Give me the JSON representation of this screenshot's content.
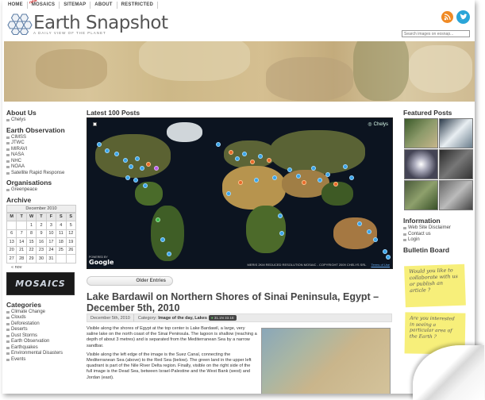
{
  "nav": [
    "HOME",
    "MOSAICS",
    "SITEMAP",
    "ABOUT",
    "RESTRICTED"
  ],
  "nav_new": "new",
  "site": {
    "title": "Earth Snapshot",
    "tagline": "A DAILY VIEW OF THE PLANET"
  },
  "search": {
    "placeholder": "Search images on eosnap..."
  },
  "left": {
    "about_title": "About Us",
    "about_items": [
      "Chelys"
    ],
    "eo_title": "Earth Observation",
    "eo_items": [
      "CIMSS",
      "JTWC",
      "MIRAVI",
      "NASA",
      "NHC",
      "NOAA",
      "Satellite Rapid Response"
    ],
    "org_title": "Organisations",
    "org_items": [
      "Greenpeace"
    ],
    "archive_title": "Archive",
    "calendar": {
      "month": "December 2010",
      "days": [
        "M",
        "T",
        "W",
        "T",
        "F",
        "S",
        "S"
      ],
      "weeks": [
        [
          "",
          "",
          "1",
          "2",
          "3",
          "4",
          "5"
        ],
        [
          "6",
          "7",
          "8",
          "9",
          "10",
          "11",
          "12"
        ],
        [
          "13",
          "14",
          "15",
          "16",
          "17",
          "18",
          "19"
        ],
        [
          "20",
          "21",
          "22",
          "23",
          "24",
          "25",
          "26"
        ],
        [
          "27",
          "28",
          "29",
          "30",
          "31",
          "",
          ""
        ]
      ],
      "prev": "« nov"
    },
    "mosaics_label": "MOSAICS",
    "categories_title": "Categories",
    "categories": [
      "Climate Change",
      "Clouds",
      "Deforestation",
      "Deserts",
      "Dust Storms",
      "Earth Observation",
      "Earthquakes",
      "Environmental Disasters",
      "Events"
    ]
  },
  "center": {
    "latest_title": "Latest 100 Posts",
    "map_credit": "MERIS 2KM REDUCED RESOLUTION MOSAIC - COPYRIGHT 2009 CHELYS SRL",
    "map_terms": "Terms of Use",
    "google": "Google",
    "powered_by": "POWERED BY",
    "map_brand": "Chelys",
    "older": "Older Entries",
    "post_title": "Lake Bardawil on Northern Shores of Sinai Peninsula, Egypt – December 5th, 2010",
    "post_date": "December 5th, 2010",
    "post_category_label": "Category:",
    "post_category": "Image of the day, Lakes",
    "post_coords": "31.1N 33.1E",
    "post_p1": "Visible along the shores of Egypt at the top center is Lake Bardawil, a large, very saline lake on the north coast of the Sinai Peninsula. The lagoon is shallow (reaching a depth of about 3 metres) and is separated from the Mediterranean Sea by a narrow sandbar.",
    "post_p2": "Visible along the left edge of the image is the Suez Canal, connecting the Mediterranean Sea (above) to the Red Sea (below). The green land in the upper left quadrant is part of the Nile River Delta region. Finally, visible on the right side of the full image is the Dead Sea, between Israel-Palestine and the West Bank (west) and Jordan (east)."
  },
  "right": {
    "featured_title": "Featured Posts",
    "info_title": "Information",
    "info_items": [
      "Web Site Disclaimer",
      "Contact us",
      "Login"
    ],
    "bulletin_title": "Bulletin Board",
    "note1": "Would you like to collaborate with us or publish an article ?",
    "note2": "Are you interested in seeing a particular area of the Earth ?"
  },
  "colors": {
    "accent": "#3aa4e8",
    "note": "#f7ef7a",
    "rss": "#f08a24",
    "twitter": "#3bb84a"
  }
}
